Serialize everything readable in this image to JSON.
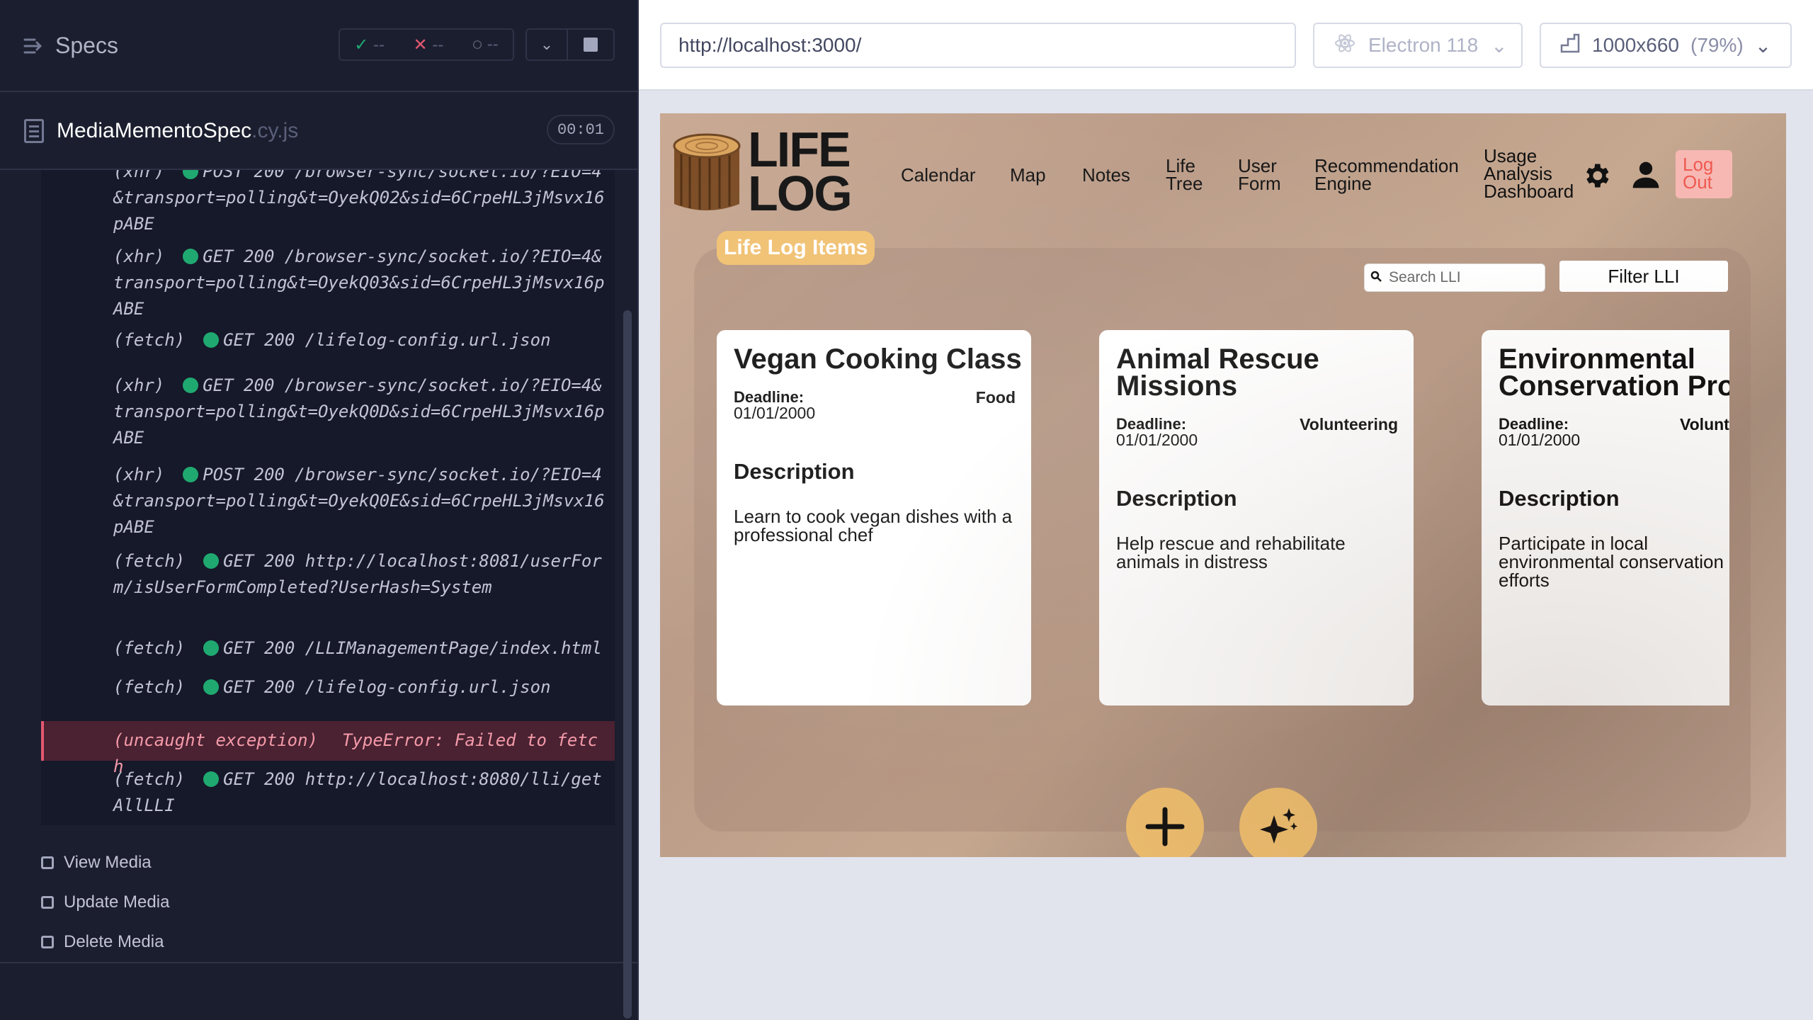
{
  "runner": {
    "header": {
      "title": "Specs",
      "passed": "--",
      "failed": "--",
      "pending": "--"
    },
    "spec": {
      "name": "MediaMementoSpec",
      "ext": ".cy.js",
      "duration": "00:01"
    },
    "log": [
      {
        "kind": "(xhr)",
        "text": "POST 200 /browser-sync/socket.io/?EIO=4&transport=polling&t=OyekQ02&sid=6CrpeHL3jMsvx16pABE"
      },
      {
        "kind": "(xhr)",
        "text": "GET 200 /browser-sync/socket.io/?EIO=4&transport=polling&t=OyekQ03&sid=6CrpeHL3jMsvx16pABE"
      },
      {
        "kind": "(fetch)",
        "text": "GET 200 /lifelog-config.url.json"
      },
      {
        "kind": "(xhr)",
        "text": "GET 200 /browser-sync/socket.io/?EIO=4&transport=polling&t=OyekQ0D&sid=6CrpeHL3jMsvx16pABE"
      },
      {
        "kind": "(xhr)",
        "text": "POST 200 /browser-sync/socket.io/?EIO=4&transport=polling&t=OyekQ0E&sid=6CrpeHL3jMsvx16pABE"
      },
      {
        "kind": "(fetch)",
        "text": "GET 200 http://localhost:8081/userForm/isUserFormCompleted?UserHash=System"
      },
      {
        "kind": "(fetch)",
        "text": "GET 200 /LLIManagementPage/index.html"
      },
      {
        "kind": "(fetch)",
        "text": "GET 200 /lifelog-config.url.json"
      },
      {
        "kind": "(uncaught exception)",
        "text": "TypeError: Failed to fetch"
      },
      {
        "kind": "(fetch)",
        "text": "GET 200 http://localhost:8080/lli/getAllLLI"
      }
    ],
    "steps": [
      "View Media",
      "Update Media",
      "Delete Media"
    ]
  },
  "browser_bar": {
    "url": "http://localhost:3000/",
    "browser": "Electron 118",
    "viewport": "1000x660",
    "zoom": "(79%)"
  },
  "app": {
    "logo": {
      "line1": "LIFE",
      "line2": "LOG"
    },
    "nav": {
      "calendar": "Calendar",
      "map": "Map",
      "notes": "Notes",
      "life_tree": "Life Tree",
      "user_form": "User Form",
      "recommendation_engine": "Recommendation Engine",
      "usage_dashboard": "Usage Analysis Dashboard",
      "logout": "Log Out"
    },
    "panel_title": "Life Log Items",
    "search_placeholder": "Search LLI",
    "filter_label": "Filter LLI",
    "cards": [
      {
        "title": "Vegan Cooking Class",
        "deadline_label": "Deadline:",
        "deadline": "01/01/2000",
        "category": "Food",
        "description_heading": "Description",
        "description": "Learn to cook vegan dishes with a professional chef"
      },
      {
        "title": "Animal Rescue Missions",
        "deadline_label": "Deadline:",
        "deadline": "01/01/2000",
        "category": "Volunteering",
        "description_heading": "Description",
        "description": "Help rescue and rehabilitate animals in distress"
      },
      {
        "title": "Environmental Conservation Projects",
        "deadline_label": "Deadline:",
        "deadline": "01/01/2000",
        "category": "Volunteering",
        "description_heading": "Description",
        "description": "Participate in local environmental conservation efforts"
      }
    ],
    "colors": {
      "accent": "#f0c070",
      "logout_bg": "#f7b8b4",
      "logout_text": "#ef5a50"
    }
  }
}
